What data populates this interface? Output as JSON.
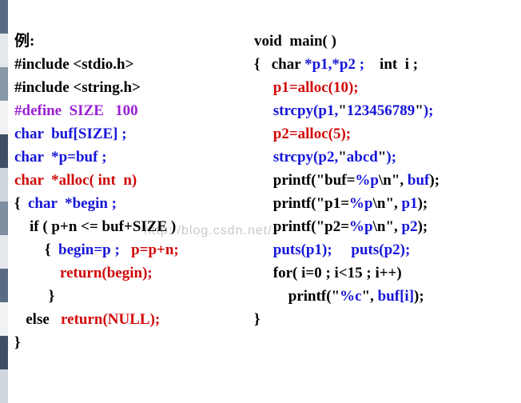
{
  "strip_colors": [
    "#5a6c84",
    "#e4e7ec",
    "#8798a8",
    "#f0f2f4",
    "#3f4f63",
    "#cfd6de",
    "#7d8ea0",
    "#e4e7ec",
    "#5a6c84",
    "#f0f2f4",
    "#3f4f63",
    "#cfd6de"
  ],
  "watermark": "http://blog.csdn.net/",
  "left": {
    "l1": "例:",
    "l2": "#include <stdio.h>",
    "l3": "#include <string.h>",
    "l4": "#define  SIZE   100",
    "l5a": "char  buf[SIZE] ;",
    "l6a": "char  *p=buf ;",
    "l7a": "char  *alloc( int  n)",
    "l8a": "{  ",
    "l8b": "char  *begin ;",
    "l9": "    if ( p+n <= buf+SIZE )",
    "l10a": "        {  ",
    "l10b": "begin=p ;   ",
    "l10c": "p=p+n;",
    "l11": "            return(begin);",
    "l12": "         }",
    "l13a": "   else   ",
    "l13b": "return(NULL);",
    "l14": "}"
  },
  "right": {
    "r1": "void  main( )",
    "r2a": "{   char ",
    "r2b": "*p1,*p2 ;",
    "r2c": "    int  i ;",
    "r3": "     p1=alloc(10);",
    "r4a": "     strcpy(p1,",
    "r4b": "\"",
    "r4c": "123456789",
    "r4d": "\"",
    "r4e": ");",
    "r5": "     p2=alloc(5);",
    "r6a": "     strcpy(p2,",
    "r6b": "\"",
    "r6c": "abcd",
    "r6d": "\"",
    "r6e": ");",
    "r7a": "     printf(",
    "r7b": "\"buf=",
    "r7c": "%p",
    "r7d": "\\n\", ",
    "r7e": "buf",
    "r7f": ");",
    "r8a": "     printf(",
    "r8b": "\"p1=",
    "r8c": "%p",
    "r8d": "\\n\", ",
    "r8e": "p1",
    "r8f": ");",
    "r9a": "     printf(",
    "r9b": "\"p2=",
    "r9c": "%p",
    "r9d": "\\n\", ",
    "r9e": "p2",
    "r9f": ");",
    "r10a": "     puts(p1);     puts(p2);",
    "r11": "     for( i=0 ; i<15 ; i++)",
    "r12a": "         printf(",
    "r12b": "\"",
    "r12c": "%c",
    "r12d": "\", ",
    "r12e": "buf[i]",
    "r12f": ");",
    "r13": "}"
  }
}
